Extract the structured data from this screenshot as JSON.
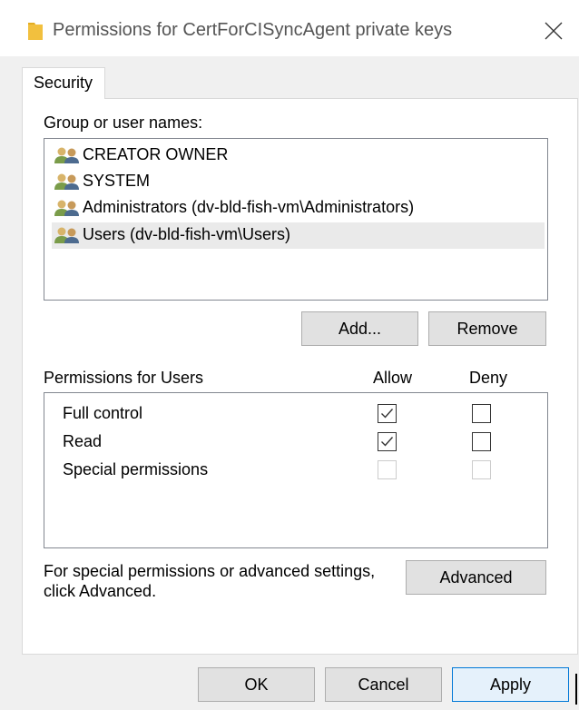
{
  "window": {
    "title": "Permissions for CertForCISyncAgent private keys"
  },
  "tabs": [
    {
      "label": "Security",
      "selected": true
    }
  ],
  "groups": {
    "label": "Group or user names:",
    "items": [
      {
        "name": "CREATOR OWNER",
        "icon": "users-icon",
        "selected": false
      },
      {
        "name": "SYSTEM",
        "icon": "users-icon",
        "selected": false
      },
      {
        "name": "Administrators (dv-bld-fish-vm\\Administrators)",
        "icon": "users-icon",
        "selected": false
      },
      {
        "name": "Users (dv-bld-fish-vm\\Users)",
        "icon": "users-icon",
        "selected": true
      }
    ],
    "add_label": "Add...",
    "remove_label": "Remove"
  },
  "permissions": {
    "label": "Permissions for Users",
    "allow_header": "Allow",
    "deny_header": "Deny",
    "rows": [
      {
        "name": "Full control",
        "allow": true,
        "deny": false,
        "enabled": true
      },
      {
        "name": "Read",
        "allow": true,
        "deny": false,
        "enabled": true
      },
      {
        "name": "Special permissions",
        "allow": false,
        "deny": false,
        "enabled": false
      }
    ]
  },
  "advanced": {
    "text_line1": "For special permissions or advanced settings,",
    "text_line2": "click Advanced.",
    "button_label": "Advanced"
  },
  "footer": {
    "ok_label": "OK",
    "cancel_label": "Cancel",
    "apply_label": "Apply"
  },
  "colors": {
    "folder": "#f2c03e",
    "selection": "#eaeaea",
    "default_button_border": "#0078d7"
  }
}
